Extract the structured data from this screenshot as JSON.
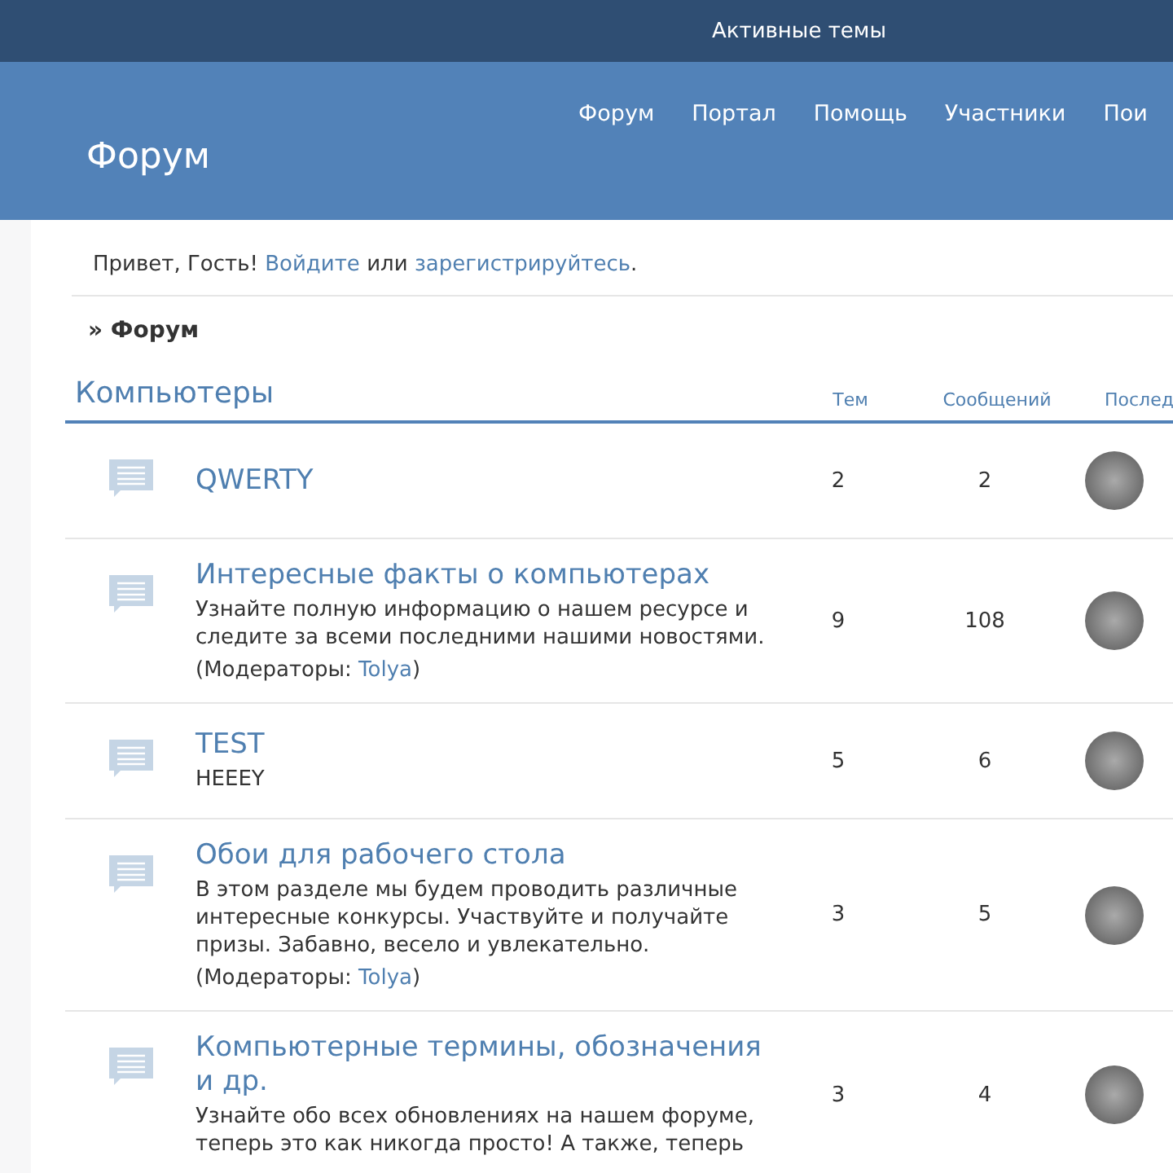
{
  "top_bar": {
    "link": "Активные темы"
  },
  "header": {
    "title": "Форум",
    "nav": [
      "Форум",
      "Портал",
      "Помощь",
      "Участники",
      "Пои"
    ]
  },
  "greeting": {
    "text": "Привет, Гость!",
    "login": "Войдите",
    "or": "или",
    "register": "зарегистрируйтесь",
    "end": "."
  },
  "breadcrumb": "» Форум",
  "category": {
    "title": "Компьютеры",
    "columns": [
      "Тем",
      "Сообщений",
      "Послед"
    ]
  },
  "boards": [
    {
      "title": "QWERTY",
      "topics": "2",
      "posts": "2"
    },
    {
      "title": "Интересные факты о компьютерах",
      "description": "Узнайте полную информацию о нашем ресурсе и следите за всеми последними нашими новостями.",
      "moderators_label": "(Модераторы:",
      "moderator": "Tolya",
      "moderators_end": ")",
      "topics": "9",
      "posts": "108"
    },
    {
      "title": "TEST",
      "description": "HEEEY",
      "topics": "5",
      "posts": "6"
    },
    {
      "title": "Обои для рабочего стола",
      "description": "В этом разделе мы будем проводить различные интересные конкурсы. Участвуйте и получайте призы. Забавно, весело и увлекательно.",
      "moderators_label": "(Модераторы:",
      "moderator": "Tolya",
      "moderators_end": ")",
      "topics": "3",
      "posts": "5"
    },
    {
      "title": "Компьютерные термины, обозначения и др.",
      "description": "Узнайте обо всех обновлениях на нашем форуме, теперь это как никогда просто! А также, теперь",
      "topics": "3",
      "posts": "4"
    }
  ]
}
